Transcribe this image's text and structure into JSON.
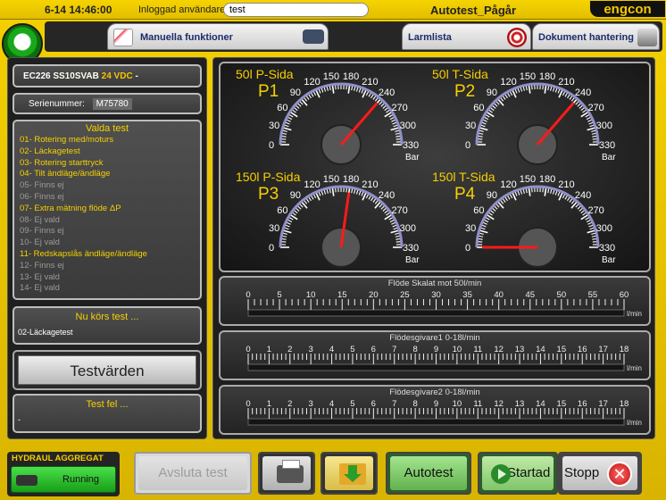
{
  "topbar": {
    "date_time": "6-14  14:46:00",
    "login_label": "Inloggad användare:",
    "user": "test",
    "status": "Autotest_Pågår",
    "logo": "engcon"
  },
  "nav": {
    "manual": "Manuella funktioner",
    "alarm": "Larmlista",
    "docs": "Dokument hantering"
  },
  "machine": {
    "model": "EC226",
    "serial_code": "SS10SVAB",
    "voltage": "24 VDC",
    "suffix": "-"
  },
  "serial": {
    "label": "Serienummer:",
    "value": "M75780"
  },
  "tests": {
    "title": "Valda test",
    "items": [
      {
        "label": "01- Rotering med/moturs",
        "active": true
      },
      {
        "label": "02- Läckagetest",
        "active": true
      },
      {
        "label": "03- Rotering starttryck",
        "active": true
      },
      {
        "label": "04- Tilt ändläge/ändläge",
        "active": true
      },
      {
        "label": "05- Finns ej",
        "active": false
      },
      {
        "label": "06- Finns ej",
        "active": false
      },
      {
        "label": "07- Extra mätning flöde ΔP",
        "active": true
      },
      {
        "label": "08- Ej vald",
        "active": false
      },
      {
        "label": "09- Finns ej",
        "active": false
      },
      {
        "label": "10- Ej vald",
        "active": false
      },
      {
        "label": "11- Redskapslås ändläge/ändläge",
        "active": true
      },
      {
        "label": "12- Finns ej",
        "active": false
      },
      {
        "label": "13- Ej vald",
        "active": false
      },
      {
        "label": "14- Ej vald",
        "active": false
      }
    ]
  },
  "current": {
    "title": "Nu körs test ...",
    "value": "02-Läckagetest"
  },
  "testvarden": "Testvärden",
  "fail": {
    "title": "Test fel ...",
    "value": "-"
  },
  "gauges": {
    "scale_labels": [
      "0",
      "30",
      "60",
      "90",
      "120",
      "150",
      "180",
      "210",
      "240",
      "270",
      "300",
      "330"
    ],
    "unit": "Bar",
    "items": [
      {
        "id": "P1",
        "label": "50l P-Sida",
        "value": 240
      },
      {
        "id": "P2",
        "label": "50l T-Sida",
        "value": 240
      },
      {
        "id": "P3",
        "label": "150l P-Sida",
        "value": 180
      },
      {
        "id": "P4",
        "label": "150l T-Sida",
        "value": 0
      }
    ]
  },
  "flows": [
    {
      "title": "Flöde  Skalat mot 50l/min",
      "unit": "l/min",
      "ticks": [
        "0",
        "5",
        "10",
        "15",
        "20",
        "25",
        "30",
        "35",
        "40",
        "45",
        "50",
        "55",
        "60"
      ],
      "max": 60
    },
    {
      "title": "Flödesgivare1  0-18l/min",
      "unit": "l/min",
      "ticks": [
        "0",
        "1",
        "2",
        "3",
        "4",
        "5",
        "6",
        "7",
        "8",
        "9",
        "10",
        "11",
        "12",
        "13",
        "14",
        "15",
        "16",
        "17",
        "18"
      ],
      "max": 18
    },
    {
      "title": "Flödesgivare2  0-18l/min",
      "unit": "l/min",
      "ticks": [
        "0",
        "1",
        "2",
        "3",
        "4",
        "5",
        "6",
        "7",
        "8",
        "9",
        "10",
        "11",
        "12",
        "13",
        "14",
        "15",
        "16",
        "17",
        "18"
      ],
      "max": 18
    }
  ],
  "hydraul": {
    "title": "HYDRAUL AGGREGAT",
    "state": "Running"
  },
  "bottom": {
    "avsluta": "Avsluta test",
    "autotest": "Autotest",
    "start": "Startad",
    "stop": "Stopp"
  }
}
